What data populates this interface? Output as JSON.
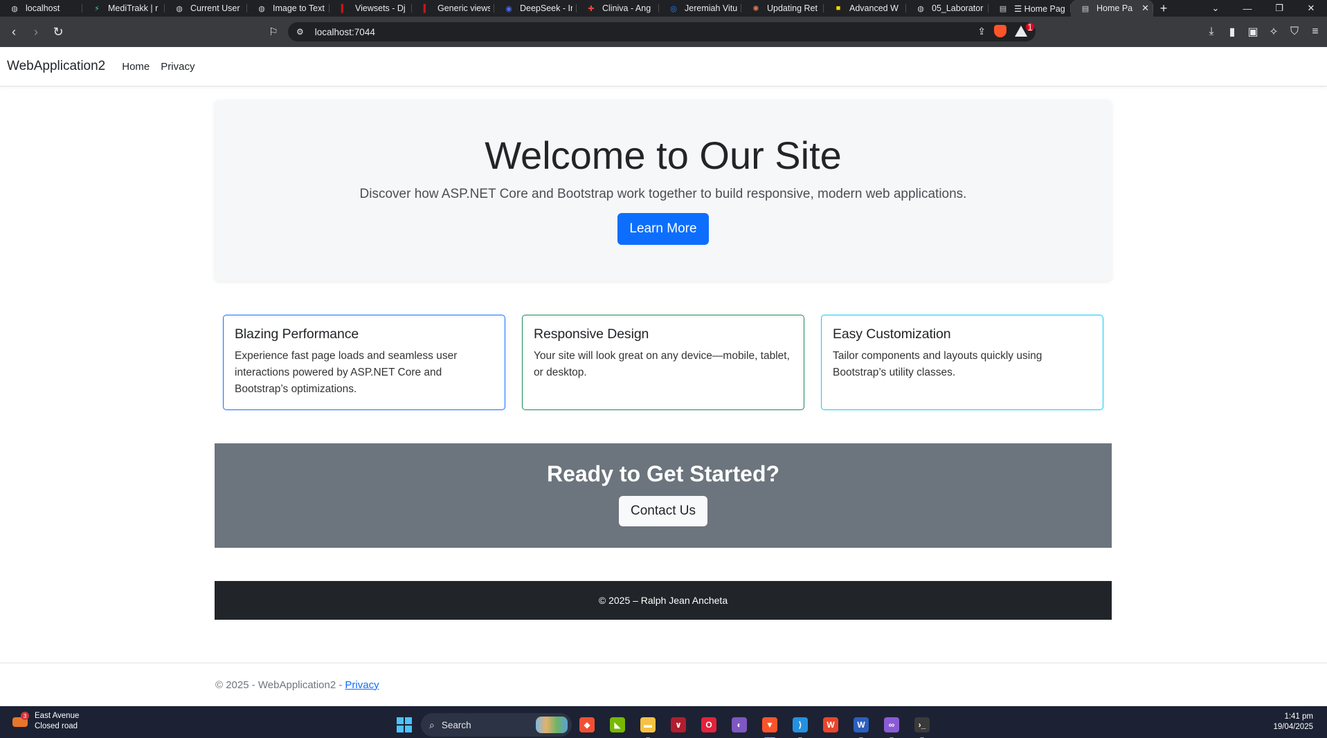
{
  "browser": {
    "tabs": [
      {
        "label": "localhost",
        "icon": "globe-icon",
        "active": false
      },
      {
        "label": "MediTrakk | r",
        "icon": "meditrakk-icon",
        "active": false
      },
      {
        "label": "Current User",
        "icon": "globe-icon",
        "active": false
      },
      {
        "label": "Image to Text",
        "icon": "globe-icon",
        "active": false
      },
      {
        "label": "Viewsets - Dj",
        "icon": "django-icon",
        "active": false
      },
      {
        "label": "Generic views",
        "icon": "django-icon",
        "active": false
      },
      {
        "label": "DeepSeek - In",
        "icon": "deepseek-icon",
        "active": false
      },
      {
        "label": "Cliniva - Ang",
        "icon": "cliniva-icon",
        "active": false
      },
      {
        "label": "Jeremiah Vitu",
        "icon": "messenger-icon",
        "active": false
      },
      {
        "label": "Updating Ret",
        "icon": "claude-icon",
        "active": false
      },
      {
        "label": "Advanced W",
        "icon": "advanced-icon",
        "active": false
      },
      {
        "label": "05_Laborator",
        "icon": "globe-icon",
        "active": false
      },
      {
        "label": "☰ Home Pag",
        "icon": "document-icon",
        "active": false
      },
      {
        "label": "Home Pa",
        "icon": "document-icon",
        "active": true
      }
    ],
    "new_tab_label": "+",
    "url": "localhost:7044"
  },
  "site": {
    "brand": "WebApplication2",
    "nav": [
      "Home",
      "Privacy"
    ],
    "hero": {
      "title": "Welcome to Our Site",
      "subtitle": "Discover how ASP.NET Core and Bootstrap work together to build responsive, modern web applications.",
      "button": "Learn More"
    },
    "features": [
      {
        "title": "Blazing Performance",
        "text": "Experience fast page loads and seamless user interactions powered by ASP.NET Core and Bootstrap’s optimizations.",
        "border_color": "#0d6efd"
      },
      {
        "title": "Responsive Design",
        "text": "Your site will look great on any device—mobile, tablet, or desktop.",
        "border_color": "#198754"
      },
      {
        "title": "Easy Customization",
        "text": "Tailor components and layouts quickly using Bootstrap’s utility classes.",
        "border_color": "#0dcaf0"
      }
    ],
    "cta": {
      "title": "Ready to Get Started?",
      "button": "Contact Us"
    },
    "dark_footer": "© 2025 – Ralph Jean Ancheta",
    "footer": {
      "text": "© 2025 - WebApplication2 - ",
      "link": "Privacy"
    }
  },
  "taskbar": {
    "weather_title": "East Avenue",
    "weather_subtitle": "Closed road",
    "weather_badge": "3",
    "search_label": "Search",
    "apps": [
      {
        "name": "git-icon",
        "color": "#f05033"
      },
      {
        "name": "nvidia-icon",
        "color": "#76b900"
      },
      {
        "name": "file-explorer-icon",
        "color": "#f5c242"
      },
      {
        "name": "vs-dev-icon",
        "color": "#b01e2f"
      },
      {
        "name": "opera-icon",
        "color": "#e2233a"
      },
      {
        "name": "github-desktop-icon",
        "color": "#7e57c2"
      },
      {
        "name": "brave-icon",
        "color": "#fb542b"
      },
      {
        "name": "vscode-icon",
        "color": "#2490e0"
      },
      {
        "name": "wps-icon",
        "color": "#e8452c"
      },
      {
        "name": "word-icon",
        "color": "#2b5fbf"
      },
      {
        "name": "visual-studio-icon",
        "color": "#8a5bd6"
      },
      {
        "name": "terminal-icon",
        "color": "#3a3a3a"
      }
    ],
    "time": "1:41 pm",
    "date": "19/04/2025"
  }
}
